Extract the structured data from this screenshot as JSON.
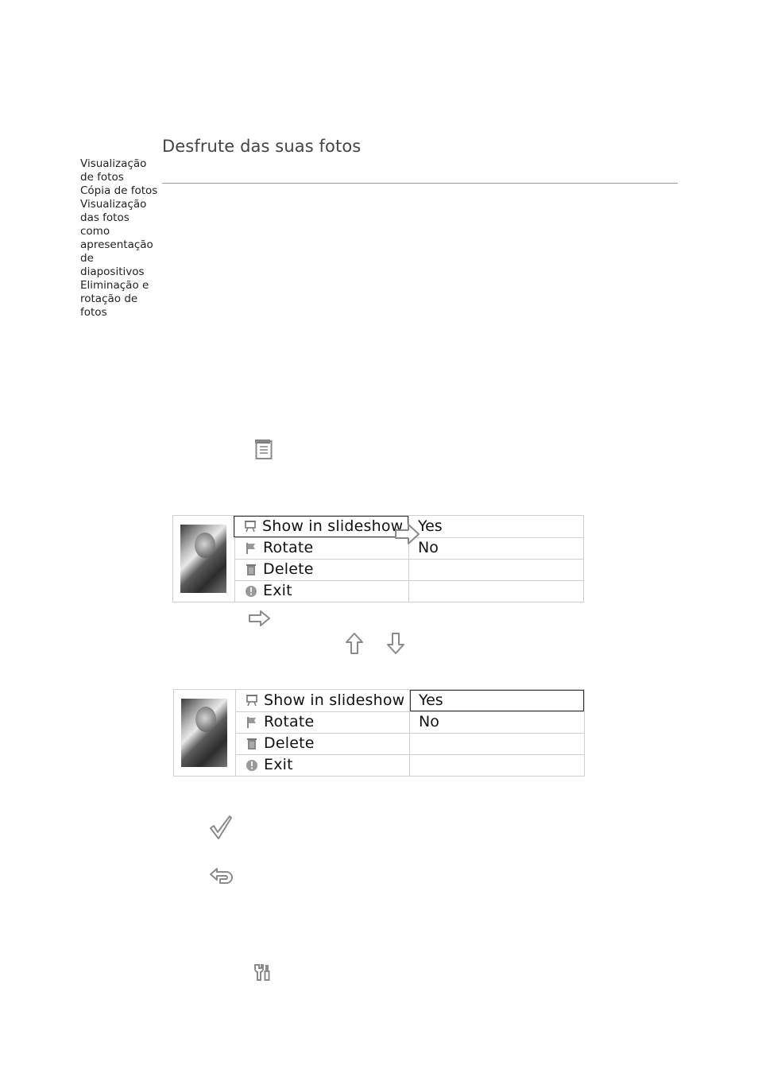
{
  "page": {
    "title": "Desfrute das suas fotos"
  },
  "sidebar": {
    "items": [
      {
        "label": "Visualização de fotos"
      },
      {
        "label": "Cópia de fotos"
      },
      {
        "label": "Visualização das fotos como apresentação de diapositivos"
      },
      {
        "label": "Eliminação e rotação de fotos"
      }
    ]
  },
  "icons": {
    "menu": "menu-icon",
    "right": "right-arrow-icon",
    "up": "up-arrow-icon",
    "down": "down-arrow-icon",
    "ok": "checkmark-icon",
    "back": "back-icon",
    "settings": "settings-icon"
  },
  "menu1": {
    "items": [
      {
        "label": "Show in slideshow",
        "icon": "slideshow-icon"
      },
      {
        "label": "Rotate",
        "icon": "flag-icon"
      },
      {
        "label": "Delete",
        "icon": "trash-icon"
      },
      {
        "label": "Exit",
        "icon": "exit-icon"
      }
    ],
    "values": [
      "Yes",
      "No",
      "",
      ""
    ],
    "selected_item": 0
  },
  "menu2": {
    "items": [
      {
        "label": "Show in slideshow",
        "icon": "slideshow-icon"
      },
      {
        "label": "Rotate",
        "icon": "flag-icon"
      },
      {
        "label": "Delete",
        "icon": "trash-icon"
      },
      {
        "label": "Exit",
        "icon": "exit-icon"
      }
    ],
    "values": [
      "Yes",
      "No",
      "",
      ""
    ],
    "selected_value": 0
  },
  "colors": {
    "text": "#222222",
    "title": "#444444",
    "rule": "#999999",
    "grid": "#cfcfcf",
    "icon": "#8a8a8a"
  }
}
